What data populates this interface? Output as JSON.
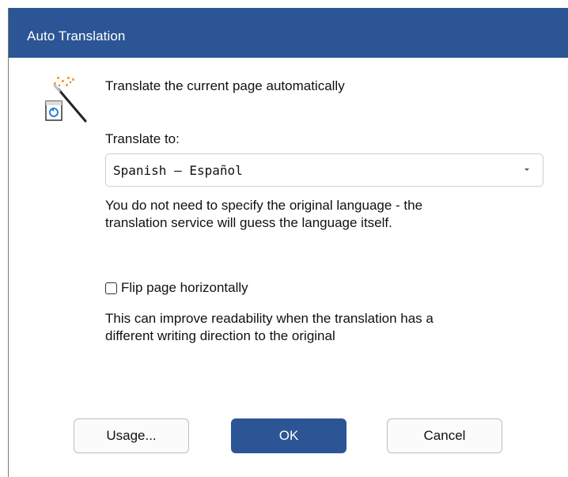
{
  "window": {
    "title": "Auto Translation"
  },
  "icon": {
    "name": "magic-wand-page-icon"
  },
  "main": {
    "heading": "Translate the current page automatically",
    "translate_to_label": "Translate to:",
    "language_select": {
      "selected": "Spanish – Español"
    },
    "language_note_line1": "You do not need to specify the original language - the",
    "language_note_line2": "translation service will guess the language itself.",
    "flip_checkbox": {
      "label": "Flip page horizontally",
      "checked": false
    },
    "flip_note_line1": "This can improve readability when the translation has a",
    "flip_note_line2": "different writing direction to the original"
  },
  "buttons": {
    "usage": "Usage...",
    "ok": "OK",
    "cancel": "Cancel"
  },
  "colors": {
    "accent": "#2c5595",
    "title_text": "#ffffff"
  }
}
